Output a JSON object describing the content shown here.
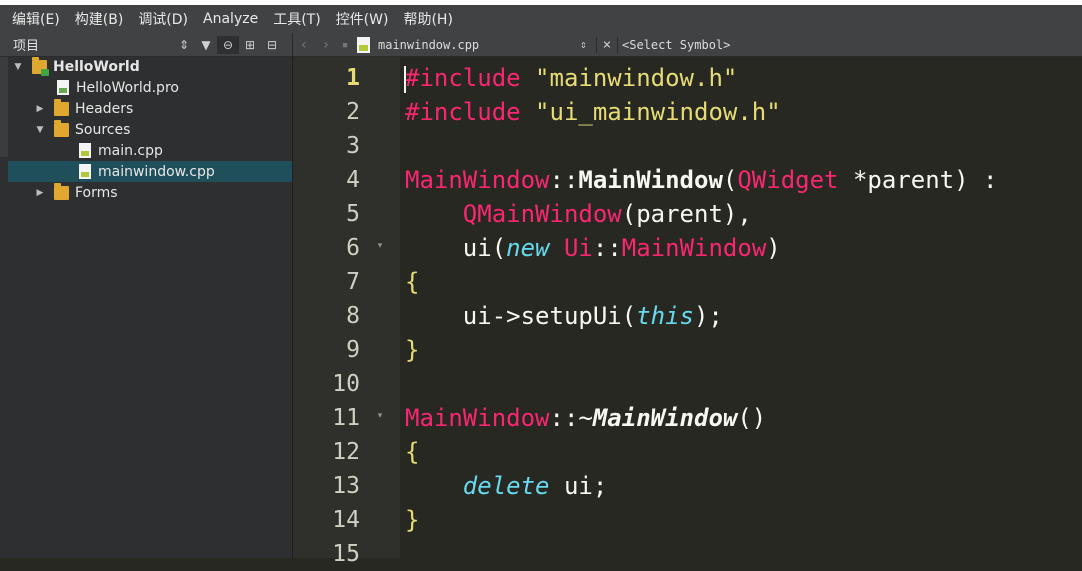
{
  "menu": [
    "编辑(E)",
    "构建(B)",
    "调试(D)",
    "Analyze",
    "工具(T)",
    "控件(W)",
    "帮助(H)"
  ],
  "project_panel": {
    "title": "项目",
    "tree": [
      {
        "label": "HelloWorld",
        "kind": "project",
        "expanded": true,
        "bold": true
      },
      {
        "label": "HelloWorld.pro",
        "kind": "pro-file"
      },
      {
        "label": "Headers",
        "kind": "folder",
        "expanded": false
      },
      {
        "label": "Sources",
        "kind": "folder",
        "expanded": true
      },
      {
        "label": "main.cpp",
        "kind": "cpp-file"
      },
      {
        "label": "mainwindow.cpp",
        "kind": "cpp-file",
        "selected": true
      },
      {
        "label": "Forms",
        "kind": "folder",
        "expanded": false
      }
    ]
  },
  "editor": {
    "file_name": "mainwindow.cpp",
    "symbol": "<Select Symbol>",
    "current_line": 1,
    "lines": [
      {
        "n": "1",
        "tokens": [
          [
            "pre",
            "#include"
          ],
          [
            "pl",
            " "
          ],
          [
            "str",
            "\"mainwindow.h\""
          ]
        ]
      },
      {
        "n": "2",
        "tokens": [
          [
            "pre",
            "#include"
          ],
          [
            "pl",
            " "
          ],
          [
            "str",
            "\"ui_mainwindow.h\""
          ]
        ]
      },
      {
        "n": "3",
        "tokens": []
      },
      {
        "n": "4",
        "tokens": [
          [
            "cls",
            "MainWindow"
          ],
          [
            "pl",
            "::"
          ],
          [
            "fn",
            "MainWindow"
          ],
          [
            "pl",
            "("
          ],
          [
            "type",
            "QWidget"
          ],
          [
            "pl",
            " *parent) :"
          ]
        ]
      },
      {
        "n": "5",
        "tokens": [
          [
            "pl",
            "    "
          ],
          [
            "type",
            "QMainWindow"
          ],
          [
            "pl",
            "(parent),"
          ]
        ]
      },
      {
        "n": "6",
        "fold": true,
        "tokens": [
          [
            "pl",
            "    ui("
          ],
          [
            "kw",
            "new"
          ],
          [
            "pl",
            " "
          ],
          [
            "type",
            "Ui"
          ],
          [
            "pl",
            "::"
          ],
          [
            "type",
            "MainWindow"
          ],
          [
            "pl",
            ")"
          ]
        ]
      },
      {
        "n": "7",
        "tokens": [
          [
            "str",
            "{"
          ]
        ]
      },
      {
        "n": "8",
        "tokens": [
          [
            "pl",
            "    ui->setupUi("
          ],
          [
            "kw",
            "this"
          ],
          [
            "pl",
            ");"
          ]
        ]
      },
      {
        "n": "9",
        "tokens": [
          [
            "str",
            "}"
          ]
        ]
      },
      {
        "n": "10",
        "tokens": []
      },
      {
        "n": "11",
        "fold": true,
        "tokens": [
          [
            "cls",
            "MainWindow"
          ],
          [
            "pl",
            "::~"
          ],
          [
            "fnI",
            "MainWindow"
          ],
          [
            "pl",
            "()"
          ]
        ]
      },
      {
        "n": "12",
        "tokens": [
          [
            "str",
            "{"
          ]
        ]
      },
      {
        "n": "13",
        "tokens": [
          [
            "pl",
            "    "
          ],
          [
            "kw",
            "delete"
          ],
          [
            "pl",
            " ui;"
          ]
        ]
      },
      {
        "n": "14",
        "tokens": [
          [
            "str",
            "}"
          ]
        ]
      },
      {
        "n": "15",
        "tokens": []
      }
    ]
  }
}
